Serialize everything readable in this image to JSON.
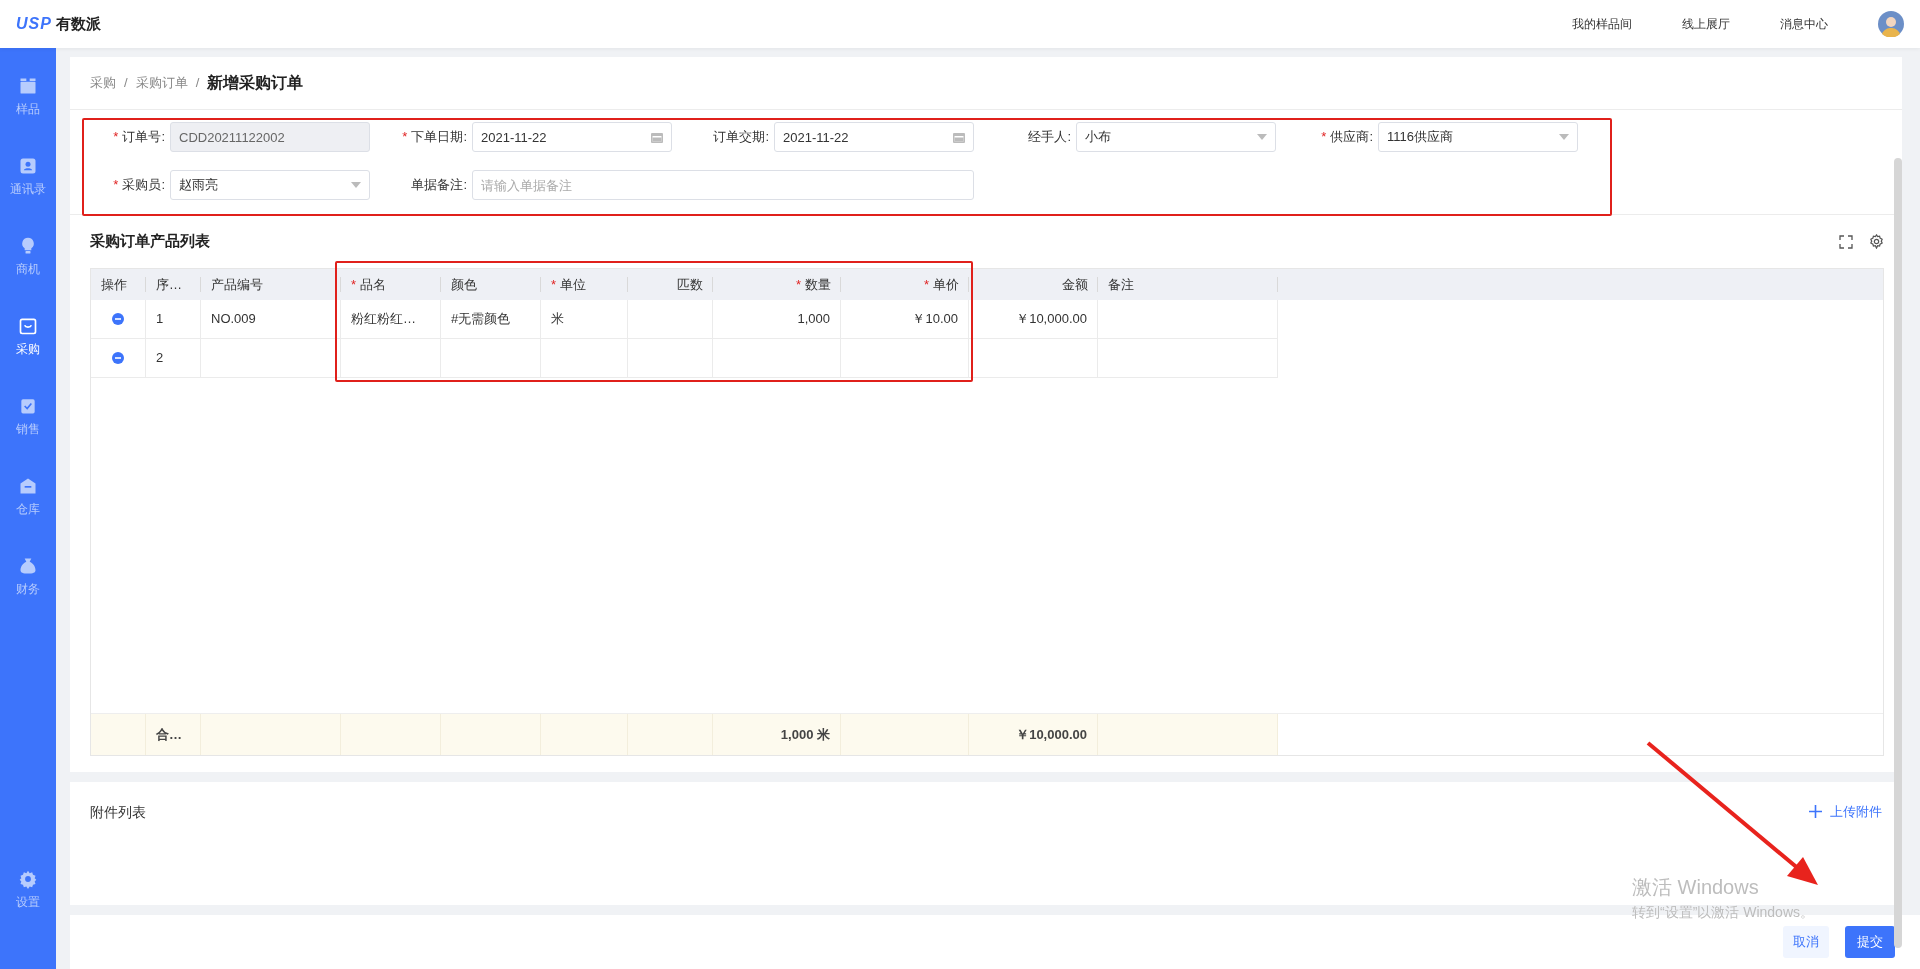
{
  "app": {
    "logo_mark": "USP",
    "logo_text": "有数派"
  },
  "top_links": [
    "我的样品间",
    "线上展厅",
    "消息中心"
  ],
  "sidebar": {
    "items": [
      {
        "label": "样品",
        "selected": false
      },
      {
        "label": "通讯录",
        "selected": false
      },
      {
        "label": "商机",
        "selected": false
      },
      {
        "label": "采购",
        "selected": true
      },
      {
        "label": "销售",
        "selected": false
      },
      {
        "label": "仓库",
        "selected": false
      },
      {
        "label": "财务",
        "selected": false
      }
    ],
    "bottom_items": [
      {
        "label": "设置",
        "selected": false
      }
    ]
  },
  "breadcrumb": {
    "separator": "/",
    "items": [
      "采购",
      "采购订单",
      "新增采购订单"
    ]
  },
  "form": {
    "required_mark": "*",
    "rows": [
      [
        {
          "label": "订单号:",
          "required": true,
          "kind": "text",
          "value": "CDD20211122002",
          "disabled": true
        },
        {
          "label": "下单日期:",
          "required": true,
          "kind": "date",
          "value": "2021-11-22",
          "disabled": false
        },
        {
          "label": "订单交期:",
          "required": false,
          "kind": "date",
          "value": "2021-11-22",
          "disabled": false
        },
        {
          "label": "经手人:",
          "required": false,
          "kind": "select",
          "value": "小布",
          "disabled": false
        },
        {
          "label": "供应商:",
          "required": true,
          "kind": "select",
          "value": "1116供应商",
          "disabled": false
        }
      ],
      [
        {
          "label": "采购员:",
          "required": true,
          "kind": "select",
          "value": "赵雨亮",
          "disabled": false
        },
        {
          "label": "单据备注:",
          "required": false,
          "kind": "wide_text",
          "placeholder": "请输入单据备注",
          "disabled": false
        }
      ]
    ]
  },
  "product_table": {
    "title": "采购订单产品列表",
    "required_mark": "*",
    "columns": [
      {
        "label": "操作",
        "required": false,
        "kind": "action"
      },
      {
        "label": "序…",
        "required": false,
        "kind": "text"
      },
      {
        "label": "产品编号",
        "required": false,
        "kind": "text"
      },
      {
        "label": "品名",
        "required": true,
        "kind": "text"
      },
      {
        "label": "颜色",
        "required": false,
        "kind": "text"
      },
      {
        "label": "单位",
        "required": true,
        "kind": "text"
      },
      {
        "label": "匹数",
        "required": false,
        "kind": "number"
      },
      {
        "label": "数量",
        "required": true,
        "kind": "quantity"
      },
      {
        "label": "单价",
        "required": true,
        "kind": "number"
      },
      {
        "label": "金额",
        "required": false,
        "kind": "amount"
      },
      {
        "label": "备注",
        "required": false,
        "kind": "text"
      }
    ],
    "rows": [
      [
        null,
        "1",
        "NO.009",
        "粉红粉红…",
        "#无需颜色",
        "米",
        null,
        "1,000",
        "￥10.00",
        "￥10,000.00",
        null
      ],
      [
        null,
        "2",
        null,
        null,
        null,
        null,
        null,
        null,
        null,
        null,
        null
      ]
    ],
    "footer": {
      "label": "合…",
      "quantity_total": "1,000 米",
      "amount_total": "￥10,000.00"
    }
  },
  "attachments": {
    "title": "附件列表",
    "upload_label": "上传附件"
  },
  "windows_notice": {
    "title": "激活 Windows",
    "subtitle": "转到“设置”以激活 Windows。"
  },
  "actions": [
    {
      "label": "取消",
      "kind": "secondary"
    },
    {
      "label": "提交",
      "kind": "primary"
    }
  ]
}
